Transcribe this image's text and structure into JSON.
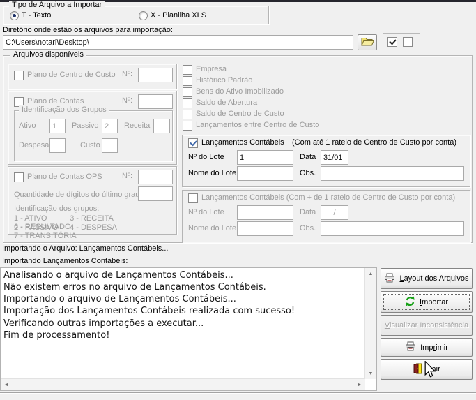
{
  "colors": {
    "background": "#f0f0f0",
    "importar_icon_green": "#18a018",
    "folder_icon_yellow": "#efe070",
    "exit_door_yellow": "#ffe81a",
    "exit_door_red": "#8b2222",
    "check_blue": "#4169aa"
  },
  "file_type": {
    "title": "Tipo de Arquivo a Importar",
    "options": [
      {
        "label": "T - Texto",
        "selected": true
      },
      {
        "label": "X - Planilha XLS",
        "selected": false
      }
    ]
  },
  "directory": {
    "label": "Diretório onde estão os arquivos para importação:",
    "value": "C:\\Users\\notari\\Desktop\\"
  },
  "available_files": {
    "title": "Arquivos disponíveis",
    "plano_centro_custo": {
      "label": "Plano de Centro de Custo",
      "numero_label": "Nº:",
      "numero_value": ""
    },
    "plano_contas": {
      "label": "Plano de Contas",
      "numero_label": "Nº:",
      "numero_value": "",
      "grupos_title": "Identificação dos Grupos",
      "ativo_label": "Ativo",
      "ativo_value": "1",
      "passivo_label": "Passivo",
      "passivo_value": "2",
      "receita_label": "Receita",
      "receita_value": "",
      "despesa_label": "Despesa",
      "despesa_value": "",
      "custo_label": "Custo",
      "custo_value": ""
    },
    "plano_contas_ops": {
      "label": "Plano de Contas OPS",
      "numero_label": "Nº:",
      "numero_value": "",
      "digitos_label": "Quantidade de dígitos do último grau",
      "digitos_value": "",
      "grupos_title": "Identificação dos grupos:",
      "grupos": [
        [
          "1 - ATIVO",
          "3 - RECEITA",
          "6 - RESULTADO"
        ],
        [
          "2 - PASSIVO",
          "4 - DESPESA",
          "7 - TRANSITÓRIA"
        ]
      ]
    },
    "import_options": [
      "Empresa",
      "Histórico Padrão",
      "Bens do Ativo Imobilizado",
      "Saldo de Abertura",
      "Saldo de Centro de Custo",
      "Lançamentos entre Centro de Custo"
    ],
    "lancamentos_simples": {
      "label": "Lançamentos Contábeis",
      "sublabel": "(Com até 1 rateio de Centro de Custo por conta)",
      "lote_label": "Nº do Lote",
      "lote_value": "1",
      "data_label": "Data",
      "data_value": "31/01",
      "nome_label": "Nome do Lote",
      "nome_value": "",
      "obs_label": "Obs.",
      "obs_value": ""
    },
    "lancamentos_multiplos": {
      "label": "Lançamentos Contábeis (Com + de 1 rateio de Centro de Custo por conta)",
      "lote_label": "Nº do Lote",
      "lote_value": "",
      "data_label": "Data",
      "data_value": "/",
      "nome_label": "Nome do Lote",
      "nome_value": "",
      "obs_label": "Obs.",
      "obs_value": ""
    }
  },
  "status": {
    "line1": "Importando o Arquivo: Lançamentos Contábeis...",
    "line2": "Importando Lançamentos Contábeis:"
  },
  "log_lines": [
    "Analisando o arquivo de Lançamentos Contábeis...",
    "Não existem erros no arquivo de Lançamentos Contábeis.",
    "Importando o arquivo de Lançamentos Contábeis...",
    "Importação dos Lançamentos Contábeis realizada com sucesso!",
    "Verificando outras importações a executar...",
    "Fim de processamento!"
  ],
  "buttons": {
    "layout": {
      "pre": "",
      "accel": "L",
      "post": "ayout dos Arquivos"
    },
    "importar": {
      "pre": "",
      "accel": "I",
      "post": "mportar"
    },
    "visualizar": {
      "pre": "",
      "accel": "V",
      "post": "isualizar Inconsistência"
    },
    "imprimir": {
      "pre": "Imp",
      "accel": "r",
      "post": "imir"
    },
    "sair": {
      "pre": "",
      "accel": "S",
      "post": "air"
    }
  }
}
